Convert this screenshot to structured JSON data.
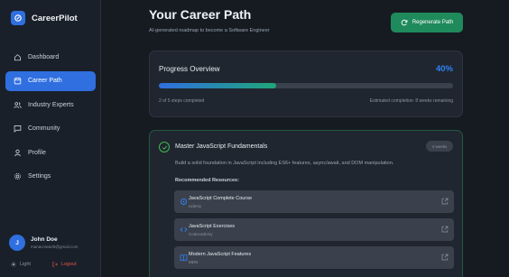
{
  "app": {
    "name": "CareerPilot",
    "accent": "#2f6fe0"
  },
  "sidebar": {
    "items": [
      {
        "label": "Dashboard",
        "icon": "home-icon",
        "active": false
      },
      {
        "label": "Career Path",
        "icon": "calendar-icon",
        "active": true
      },
      {
        "label": "Industry Experts",
        "icon": "users-icon",
        "active": false
      },
      {
        "label": "Community",
        "icon": "chat-icon",
        "active": false
      },
      {
        "label": "Profile",
        "icon": "user-icon",
        "active": false
      },
      {
        "label": "Settings",
        "icon": "gear-icon",
        "active": false
      }
    ],
    "user": {
      "initials": "J",
      "name": "John Doe",
      "email": "manav.tiwari9@gmail.com"
    },
    "footer": {
      "theme_label": "Light",
      "logout_label": "Logout"
    }
  },
  "header": {
    "title": "Your Career Path",
    "subtitle": "AI-generated roadmap to become a Software Engineer",
    "regenerate_label": "Regenerate Path"
  },
  "progress": {
    "title": "Progress Overview",
    "percent_label": "40%",
    "percent": 40,
    "steps_text": "2 of 5 steps completed",
    "estimate_text": "Estimated completion: 8 weeks remaining"
  },
  "step": {
    "title": "Master JavaScript Fundamentals",
    "badge": "4 weeks",
    "description": "Build a solid foundation in JavaScript including ES6+ features, async/await, and DOM manipulation.",
    "resources_heading": "Recommended Resources:",
    "resources": [
      {
        "title": "JavaScript Complete Course",
        "provider": "Udemy",
        "icon": "video-icon"
      },
      {
        "title": "JavaScript Exercises",
        "provider": "Codecademy",
        "icon": "code-icon"
      },
      {
        "title": "Modern JavaScript Features",
        "provider": "MDN",
        "icon": "book-icon"
      }
    ]
  },
  "colors": {
    "success": "#3fb950",
    "button_green": "#1f8a5b",
    "logout_red": "#e5534b"
  }
}
